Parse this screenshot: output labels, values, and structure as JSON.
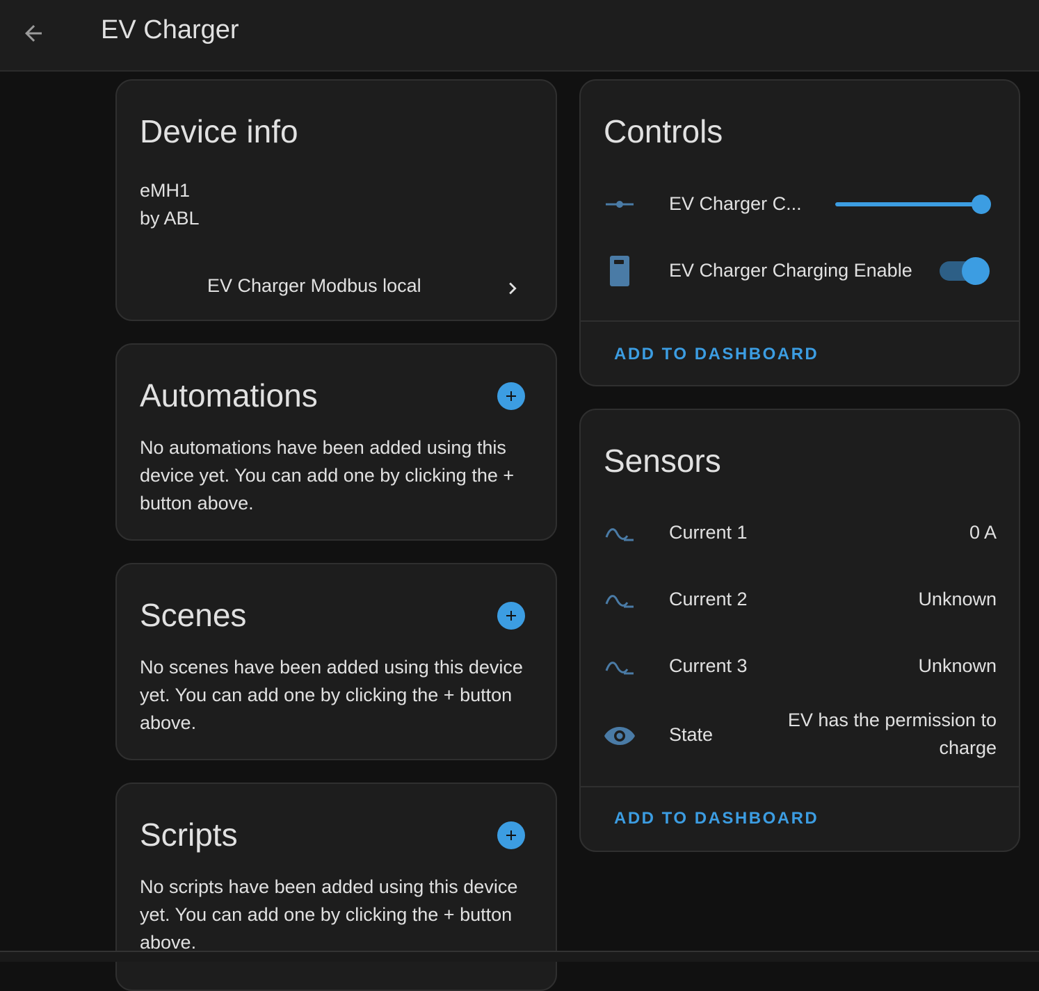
{
  "header": {
    "title": "EV Charger"
  },
  "device_info": {
    "title": "Device info",
    "model": "eMH1",
    "manufacturer": "by ABL",
    "integration_link": "EV Charger Modbus local"
  },
  "automations": {
    "title": "Automations",
    "empty_text": "No automations have been added using this device yet. You can add one by clicking the + button above."
  },
  "scenes": {
    "title": "Scenes",
    "empty_text": "No scenes have been added using this device yet. You can add one by clicking the + button above."
  },
  "scripts": {
    "title": "Scripts",
    "empty_text": "No scripts have been added using this device yet. You can add one by clicking the + button above."
  },
  "controls": {
    "title": "Controls",
    "items": [
      {
        "label": "EV Charger C...",
        "icon": "slider-icon",
        "type": "slider",
        "level": 1.0
      },
      {
        "label": "EV Charger Charging Enable",
        "icon": "ev-station-icon",
        "type": "switch",
        "on": true
      }
    ],
    "add_to_dashboard": "ADD TO DASHBOARD"
  },
  "sensors": {
    "title": "Sensors",
    "items": [
      {
        "label": "Current 1",
        "value": "0 A",
        "icon": "current-ac-icon"
      },
      {
        "label": "Current 2",
        "value": "Unknown",
        "icon": "current-ac-icon"
      },
      {
        "label": "Current 3",
        "value": "Unknown",
        "icon": "current-ac-icon"
      },
      {
        "label": "State",
        "value": "EV has the permission to charge",
        "icon": "eye-icon"
      }
    ],
    "add_to_dashboard": "ADD TO DASHBOARD"
  },
  "colors": {
    "accent": "#3c9de2",
    "icon": "#4a7ba6",
    "background": "#111111",
    "card": "#1d1d1d"
  }
}
